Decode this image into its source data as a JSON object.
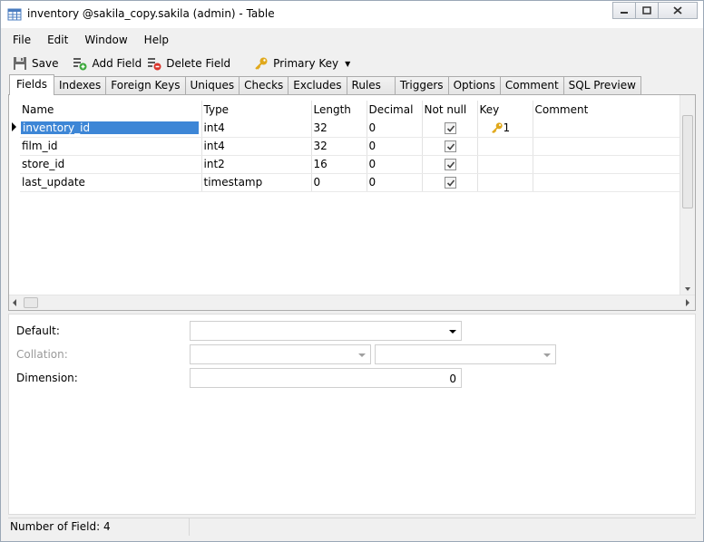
{
  "window": {
    "title": "inventory @sakila_copy.sakila (admin) - Table"
  },
  "menu": [
    "File",
    "Edit",
    "Window",
    "Help"
  ],
  "toolbar": {
    "save_label": "Save",
    "add_field_label": "Add Field",
    "delete_field_label": "Delete Field",
    "primary_key_label": "Primary Key"
  },
  "tabs": [
    "Fields",
    "Indexes",
    "Foreign Keys",
    "Uniques",
    "Checks",
    "Excludes",
    "Rules",
    "Triggers",
    "Options",
    "Comment",
    "SQL Preview"
  ],
  "grid": {
    "columns": [
      "Name",
      "Type",
      "Length",
      "Decimal",
      "Not null",
      "Key",
      "Comment"
    ],
    "rows": [
      {
        "name": "inventory_id",
        "type": "int4",
        "length": "32",
        "decimal": "0",
        "not_null": true,
        "key": "1",
        "comment": ""
      },
      {
        "name": "film_id",
        "type": "int4",
        "length": "32",
        "decimal": "0",
        "not_null": true,
        "key": "",
        "comment": ""
      },
      {
        "name": "store_id",
        "type": "int2",
        "length": "16",
        "decimal": "0",
        "not_null": true,
        "key": "",
        "comment": ""
      },
      {
        "name": "last_update",
        "type": "timestamp",
        "length": "0",
        "decimal": "0",
        "not_null": true,
        "key": "",
        "comment": ""
      }
    ]
  },
  "properties": {
    "default_label": "Default:",
    "default_value": "",
    "collation_label": "Collation:",
    "dimension_label": "Dimension:",
    "dimension_value": "0"
  },
  "status": {
    "field_count": "Number of Field: 4"
  },
  "colors": {
    "selection": "#3d86d6",
    "key_icon": "#e0a81b"
  }
}
